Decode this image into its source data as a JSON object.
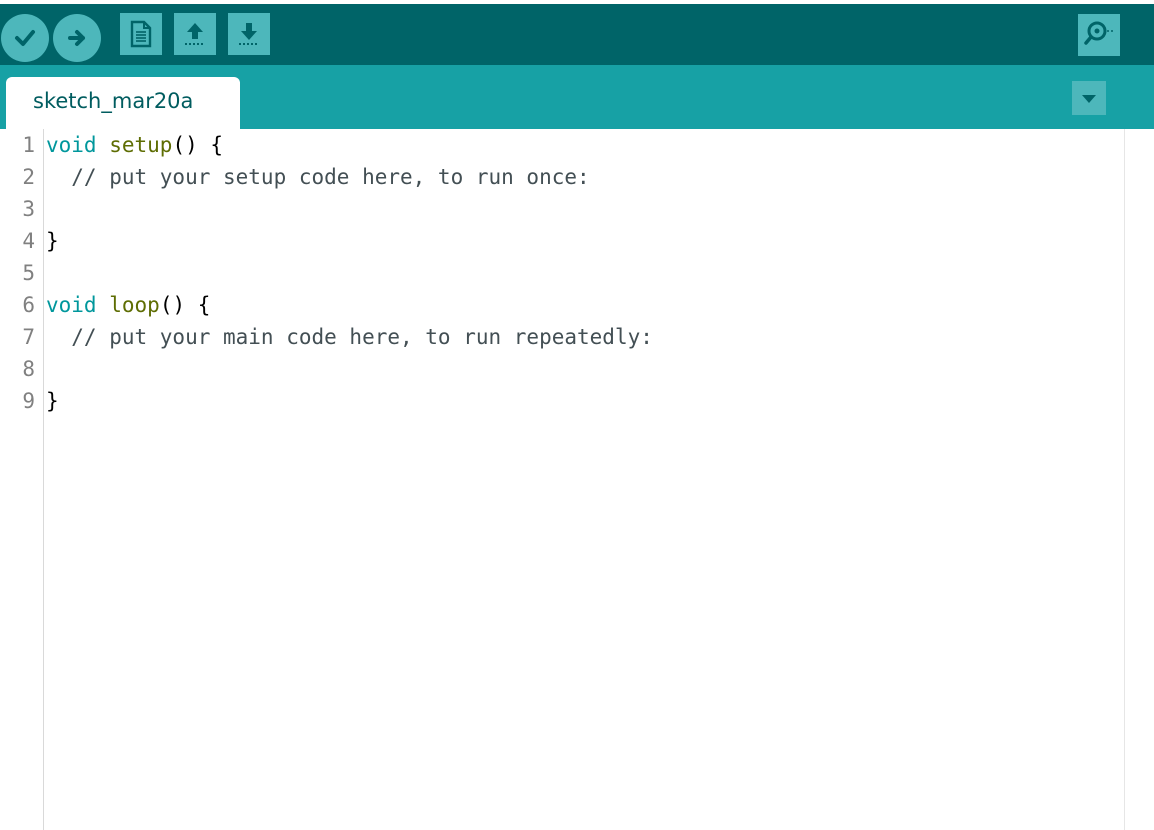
{
  "toolbar": {
    "buttons": [
      {
        "name": "verify",
        "icon": "check-icon"
      },
      {
        "name": "upload",
        "icon": "arrow-right-icon"
      },
      {
        "name": "new",
        "icon": "new-file-icon"
      },
      {
        "name": "open",
        "icon": "arrow-up-icon"
      },
      {
        "name": "save",
        "icon": "arrow-down-icon"
      }
    ],
    "serial_monitor_icon": "magnifier-icon"
  },
  "tabs": [
    {
      "label": "sketch_mar20a",
      "active": true
    }
  ],
  "tab_menu_icon": "triangle-down-icon",
  "editor": {
    "line_numbers": [
      "1",
      "2",
      "3",
      "4",
      "5",
      "6",
      "7",
      "8",
      "9"
    ],
    "lines": [
      {
        "kw": "void",
        "fn": "setup",
        "rest": "() {",
        "comment": ""
      },
      {
        "kw": "",
        "fn": "",
        "rest": "",
        "comment": "  // put your setup code here, to run once:"
      },
      {
        "kw": "",
        "fn": "",
        "rest": "",
        "comment": ""
      },
      {
        "kw": "",
        "fn": "",
        "rest": "}",
        "comment": ""
      },
      {
        "kw": "",
        "fn": "",
        "rest": "",
        "comment": ""
      },
      {
        "kw": "void",
        "fn": "loop",
        "rest": "() {",
        "comment": ""
      },
      {
        "kw": "",
        "fn": "",
        "rest": "",
        "comment": "  // put your main code here, to run repeatedly:"
      },
      {
        "kw": "",
        "fn": "",
        "rest": "",
        "comment": ""
      },
      {
        "kw": "",
        "fn": "",
        "rest": "}",
        "comment": ""
      }
    ]
  },
  "colors": {
    "toolbar_bg": "#006468",
    "tabbar_bg": "#17a1a5",
    "button_bg": "#4db7bb",
    "keyword": "#00979c",
    "function": "#5e6d03"
  }
}
